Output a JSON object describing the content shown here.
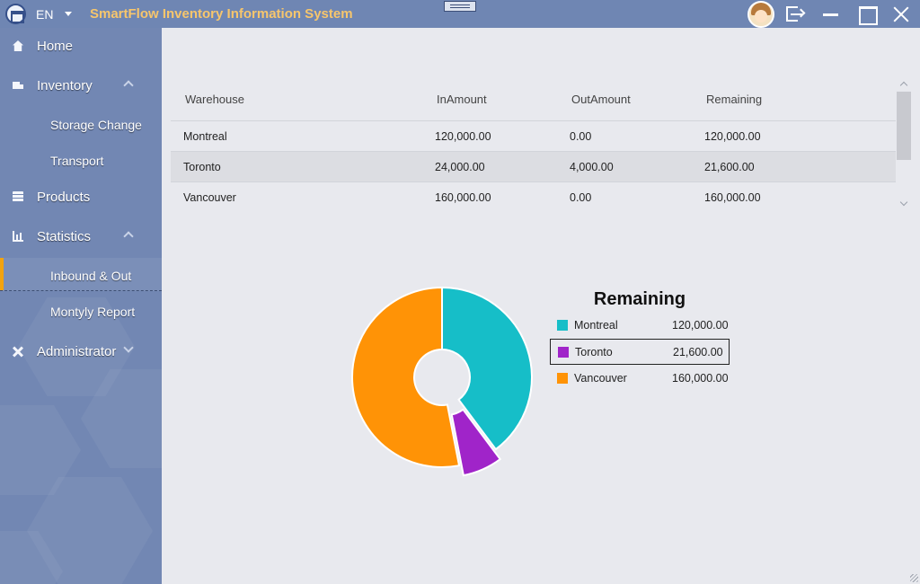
{
  "titlebar": {
    "language": "EN",
    "app_title": "SmartFlow Inventory Information System"
  },
  "sidebar": {
    "items": [
      {
        "label": "Home",
        "icon": "home-icon"
      },
      {
        "label": "Inventory",
        "icon": "inventory-icon",
        "expanded": true
      },
      {
        "label": "Storage Change"
      },
      {
        "label": "Transport"
      },
      {
        "label": "Products",
        "icon": "products-icon"
      },
      {
        "label": "Statistics",
        "icon": "statistics-icon",
        "expanded": true
      },
      {
        "label": "Inbound & Out",
        "active": true
      },
      {
        "label": "Montyly Report"
      },
      {
        "label": "Administrator",
        "icon": "tools-icon",
        "expanded": false
      }
    ],
    "accent_color": "#f2a30f"
  },
  "table": {
    "columns": [
      "Warehouse",
      "InAmount",
      "OutAmount",
      "Remaining"
    ],
    "rows": [
      [
        "Montreal",
        "120,000.00",
        "0.00",
        "120,000.00"
      ],
      [
        "Toronto",
        "24,000.00",
        "4,000.00",
        "21,600.00"
      ],
      [
        "Vancouver",
        "160,000.00",
        "0.00",
        "160,000.00"
      ]
    ]
  },
  "chart_data": {
    "type": "pie",
    "title": "Remaining",
    "categories": [
      "Montreal",
      "Toronto",
      "Vancouver"
    ],
    "values": [
      120000,
      21600,
      160000
    ],
    "value_labels": [
      "120,000.00",
      "21,600.00",
      "160,000.00"
    ],
    "colors": [
      "#16bec8",
      "#a024c9",
      "#ff9306"
    ],
    "selected": "Toronto",
    "donut": true,
    "legend_position": "right"
  }
}
